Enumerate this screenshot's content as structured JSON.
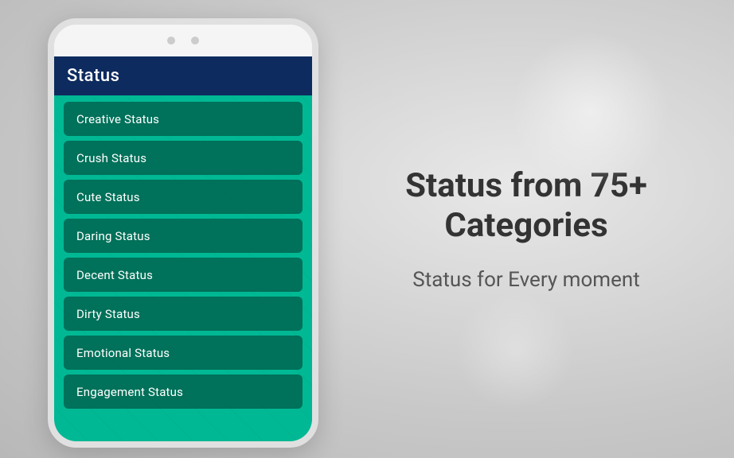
{
  "phone": {
    "app_title": "Status",
    "menu_items": [
      {
        "id": "creative",
        "label": "Creative Status"
      },
      {
        "id": "crush",
        "label": "Crush Status"
      },
      {
        "id": "cute",
        "label": "Cute Status"
      },
      {
        "id": "daring",
        "label": "Daring Status"
      },
      {
        "id": "decent",
        "label": "Decent Status"
      },
      {
        "id": "dirty",
        "label": "Dirty Status"
      },
      {
        "id": "emotional",
        "label": "Emotional Status"
      },
      {
        "id": "engagement",
        "label": "Engagement Status"
      }
    ]
  },
  "right_panel": {
    "tagline_main": "Status from 75+ Categories",
    "tagline_sub": "Status for Every moment"
  }
}
